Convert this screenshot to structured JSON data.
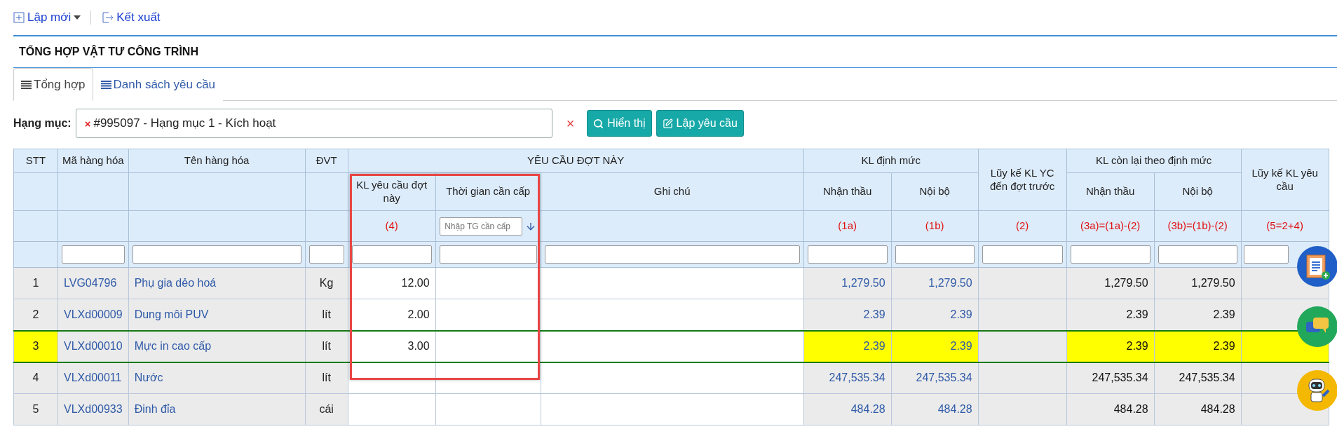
{
  "toolbar": [
    {
      "label": "Lập mới",
      "kind": "new"
    },
    {
      "label": "Kết xuất",
      "kind": "export"
    }
  ],
  "title": "TỔNG HỢP VẬT TƯ CÔNG TRÌNH",
  "tabs": [
    {
      "label": "Tổng hợp",
      "selected": true
    },
    {
      "label": "Danh sách yêu cầu",
      "selected": false
    }
  ],
  "filter": {
    "label": "Hạng mục:",
    "tag_remove": "×",
    "tag": "#995097 - Hạng mục 1 - Kích hoạt",
    "clear": "×",
    "buttons": [
      {
        "label": "Hiển thị",
        "kind": "search"
      },
      {
        "label": "Lập yêu cầu",
        "kind": "edit"
      }
    ]
  },
  "table": {
    "header": [
      {
        "label": "STT",
        "kind": "index"
      },
      {
        "label": "Mã hàng hóa",
        "kind": "link"
      },
      {
        "label": "Tên hàng hóa",
        "kind": "link"
      },
      {
        "label": "ĐVT",
        "kind": "unit"
      },
      {
        "group": "YÊU CẦU ĐỢT NÀY",
        "columns": [
          {
            "label": "KL yêu cầu đợt này",
            "formula": "(4)",
            "kind": "input"
          },
          {
            "label": "Thời gian cần cấp",
            "placeholder": "Nhập TG cần cấp",
            "kind": "input"
          },
          {
            "label": "Ghi chú",
            "kind": "input"
          }
        ]
      },
      {
        "group": "KL định mức",
        "columns": [
          {
            "label": "Nhận thầu",
            "formula": "(1a)",
            "kind": "link_number"
          },
          {
            "label": "Nội bộ",
            "formula": "(1b)",
            "kind": "link_number"
          }
        ]
      },
      {
        "label": "Lũy kế KL YC đến đợt trước",
        "formula": "(2)",
        "kind": "plain_number"
      },
      {
        "group": "KL còn lại theo định mức",
        "columns": [
          {
            "label": "Nhận thầu",
            "formula": "(3a)=(1a)-(2)",
            "kind": "number"
          },
          {
            "label": "Nội bộ",
            "formula": "(3b)=(1b)-(2)",
            "kind": "number"
          }
        ]
      },
      {
        "label": "Lũy kế KL yêu cầu",
        "formula": "(5=2+4)",
        "kind": "number"
      }
    ],
    "rows": [
      {
        "cells": [
          "1",
          "LVG04796",
          "Phụ gia dẻo hoá",
          "Kg",
          "12.00",
          "",
          "",
          "1,279.50",
          "1,279.50",
          "",
          "1,279.50",
          "1,279.50",
          ""
        ],
        "highlighted": false
      },
      {
        "cells": [
          "2",
          "VLXd00009",
          "Dung môi PUV",
          "lít",
          "2.00",
          "",
          "",
          "2.39",
          "2.39",
          "",
          "2.39",
          "2.39",
          ""
        ],
        "highlighted": false
      },
      {
        "cells": [
          "3",
          "VLXd00010",
          "Mực in cao cấp",
          "lít",
          "3.00",
          "",
          "",
          "2.39",
          "2.39",
          "",
          "2.39",
          "2.39",
          ""
        ],
        "highlighted": true
      },
      {
        "cells": [
          "4",
          "VLXd00011",
          "Nước",
          "lít",
          "",
          "",
          "",
          "247,535.34",
          "247,535.34",
          "",
          "247,535.34",
          "247,535.34",
          ""
        ],
        "highlighted": false
      },
      {
        "cells": [
          "5",
          "VLXd00933",
          "Đinh đỉa",
          "cái",
          "",
          "",
          "",
          "484.28",
          "484.28",
          "",
          "484.28",
          "484.28",
          ""
        ],
        "highlighted": false
      }
    ]
  }
}
